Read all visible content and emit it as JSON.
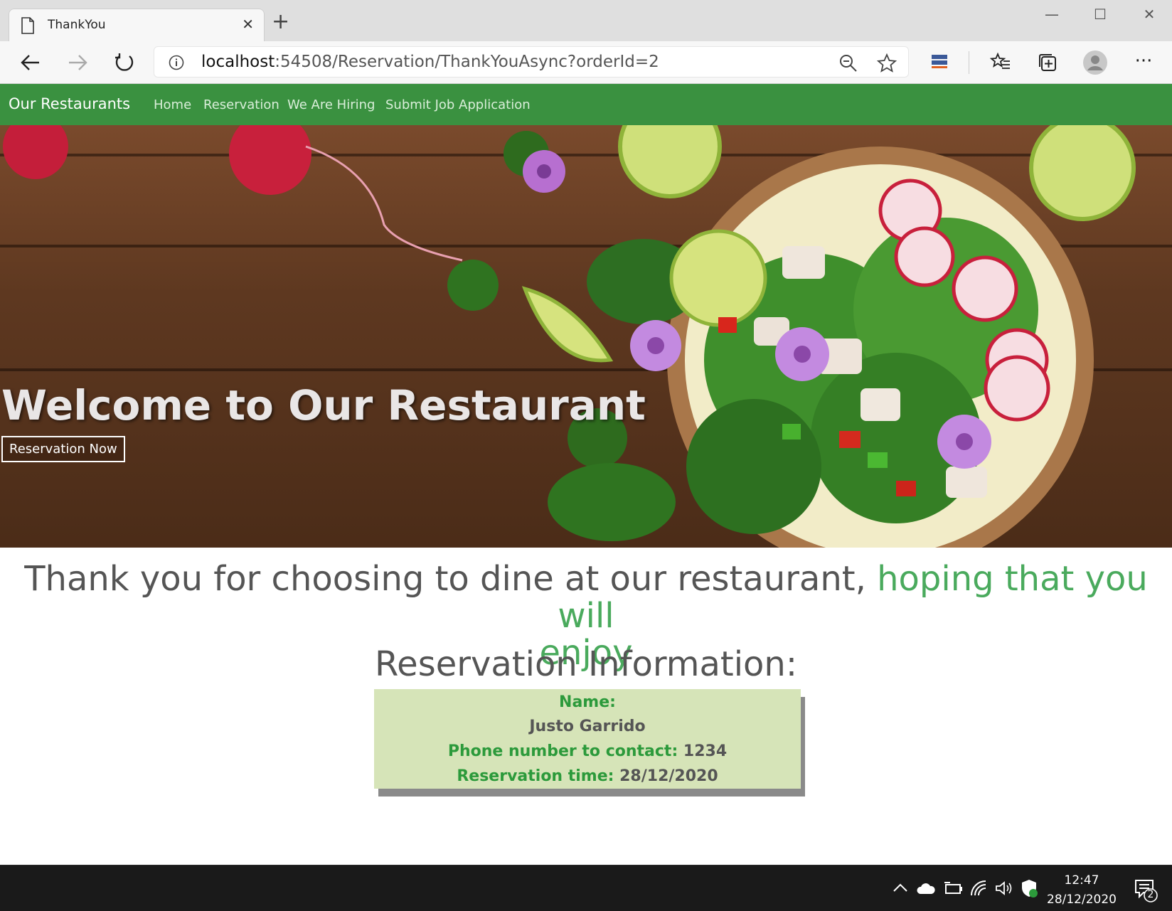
{
  "browser": {
    "tab_title": "ThankYou",
    "tab_close": "✕",
    "new_tab": "+",
    "address_host": "localhost",
    "address_path": ":54508/Reservation/ThankYouAsync?orderId=2",
    "window_controls": {
      "minimize": "—",
      "maximize": "☐",
      "close": "✕"
    },
    "icons": [
      "back-icon",
      "forward-icon",
      "refresh-icon",
      "info-icon",
      "zoom-icon",
      "favorite-star-icon",
      "extension-icon",
      "favorites-icon",
      "collections-icon",
      "profile-icon",
      "more-icon"
    ],
    "more_label": "···"
  },
  "site_nav": {
    "brand": "Our Restaurants",
    "links": [
      "Home",
      "Reservation",
      "We Are Hiring",
      "Submit Job Application"
    ],
    "accent_color": "#3a9140"
  },
  "hero": {
    "title": "Welcome to Our Restaurant",
    "button_label": "Reservation Now"
  },
  "thank_you": {
    "text": "Thank you for choosing to dine at our restaurant,",
    "highlight_1": "hoping that you will",
    "highlight_2": "enjoy",
    "highlight_color": "#4aaa5d"
  },
  "reservation": {
    "heading": "Reservation Information:",
    "name_label": "Name:",
    "name_value": "Justo Garrido",
    "phone_label": "Phone number to contact:",
    "phone_value": "1234",
    "time_label": "Reservation time:",
    "time_value": "28/12/2020",
    "box_color": "#d6e4b8"
  },
  "taskbar": {
    "time": "12:47",
    "date": "28/12/2020",
    "notification_count": "2",
    "tray_icons": [
      "chevron-up-icon",
      "onedrive-icon",
      "battery-icon",
      "wifi-icon",
      "volume-icon",
      "security-icon",
      "notification-icon"
    ]
  }
}
